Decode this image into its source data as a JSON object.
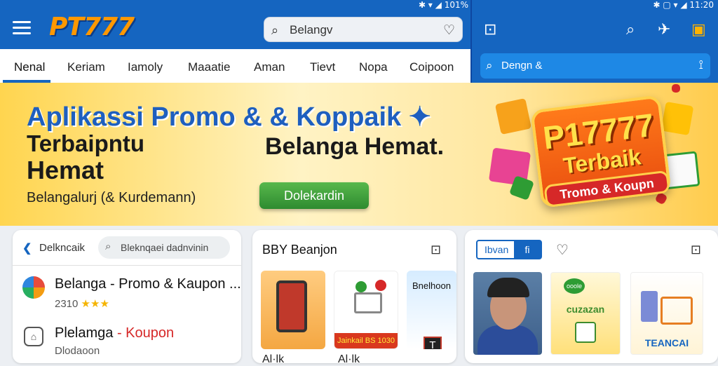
{
  "status": {
    "left": "101%",
    "right": "11:20"
  },
  "header": {
    "logo": "PT777",
    "search_value": "Belangv",
    "colors": {
      "primary": "#1565c0",
      "accent": "#ff9800"
    }
  },
  "tabs": [
    "Nenal",
    "Keriam",
    "Iamoly",
    "Maaatie",
    "Aman",
    "Tievt",
    "Nopa",
    "Coipoon"
  ],
  "right_search": {
    "value": "Dengn & "
  },
  "banner": {
    "title": "Aplikassi Promo & & Koppaik",
    "line1": "Terbaipntu",
    "line2": "Hemat",
    "mid": "Belanga Hemat.",
    "small": "Belangalurj (& Kurdemann)",
    "button": "Dolekardin",
    "badge_num": "P17777",
    "badge_t2": "Terbaik",
    "badge_ribbon": "Tromo & Koupn"
  },
  "card1": {
    "back_label": "Delkncaik",
    "search_placeholder": "Bleknqaei dadnvinin",
    "app1": {
      "title": "Belanga - Promo & Kaupon ...",
      "rating": "2310"
    },
    "app2": {
      "title": "Plelamga",
      "title_sep": " - ",
      "title_red": "Koupon",
      "sub": "Dlodaoon"
    }
  },
  "card2": {
    "title": "BBY Beanjon",
    "thumb2_label": "Jainkail BS 1030",
    "thumb3_text": "Bnelhoon",
    "thumb3_icon": "T",
    "below": [
      "Al·lk",
      "Al·lk"
    ]
  },
  "card3": {
    "badge_left": "Ibvan",
    "badge_right": "fi",
    "promo2_text": "cuzazan",
    "promo2_dot": "ooole",
    "promo3_text": "TEANCAI"
  }
}
